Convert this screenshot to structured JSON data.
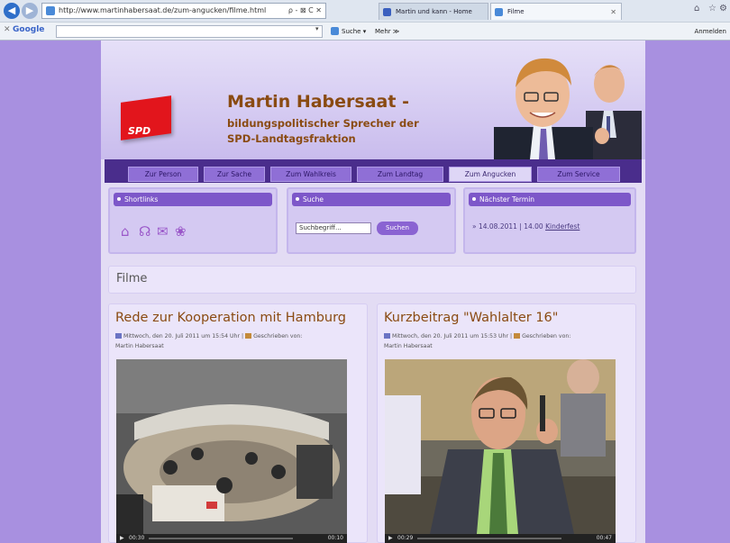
{
  "browser": {
    "url": "http://www.martinhabersaat.de/zum-angucken/filme.html",
    "url_tools": "ρ - ⊠ C ✕",
    "tabs": [
      {
        "label": "Martin und kann - Home"
      },
      {
        "label": "Filme"
      }
    ],
    "toolbar": {
      "google": "Google",
      "suche": "Suche",
      "mehr": "Mehr ≫",
      "anmelden": "Anmelden"
    },
    "colors": {
      "back": "#2f6fc9",
      "chrome": "#dfe6f0"
    }
  },
  "site": {
    "logo": "SPD",
    "title": "Martin Habersaat -",
    "subtitle_line1": "bildungspolitischer Sprecher der",
    "subtitle_line2": "SPD-Landtagsfraktion",
    "colors": {
      "title": "#8a4b12",
      "menu": "#4a2d8c",
      "box_head": "#7d57c9",
      "bg": "#a890e0"
    }
  },
  "menu": [
    {
      "label": "Zur Person"
    },
    {
      "label": "Zur Sache"
    },
    {
      "label": "Zum Wahlkreis"
    },
    {
      "label": "Zum Landtag"
    },
    {
      "label": "Zum Angucken"
    },
    {
      "label": "Zum Service"
    }
  ],
  "shortlinks": {
    "heading": "Shortlinks",
    "icons": [
      "home-icon",
      "help-icon",
      "mail-icon",
      "flower-icon"
    ]
  },
  "search": {
    "heading": "Suche",
    "placeholder": "Suchbegriff...",
    "value": "Suchbegriff...",
    "button": "Suchen"
  },
  "termin": {
    "heading": "Nächster Termin",
    "date": "» 14.08.2011 | 14.00",
    "link": "Kinderfest"
  },
  "section": {
    "title": "Filme"
  },
  "posts": [
    {
      "title": "Rede zur Kooperation mit Hamburg",
      "date": "Mittwoch, den 20. Juli 2011 um 15:54 Uhr",
      "author_label": "Geschrieben von:",
      "author": "Martin Habersaat",
      "player_time": "00:30",
      "player_end": "00:10"
    },
    {
      "title": "Kurzbeitrag \"Wahlalter 16\"",
      "date": "Mittwoch, den 20. Juli 2011 um 15:53 Uhr",
      "author_label": "Geschrieben von:",
      "author": "Martin Habersaat",
      "player_time": "00:29",
      "player_end": "00:47"
    }
  ]
}
